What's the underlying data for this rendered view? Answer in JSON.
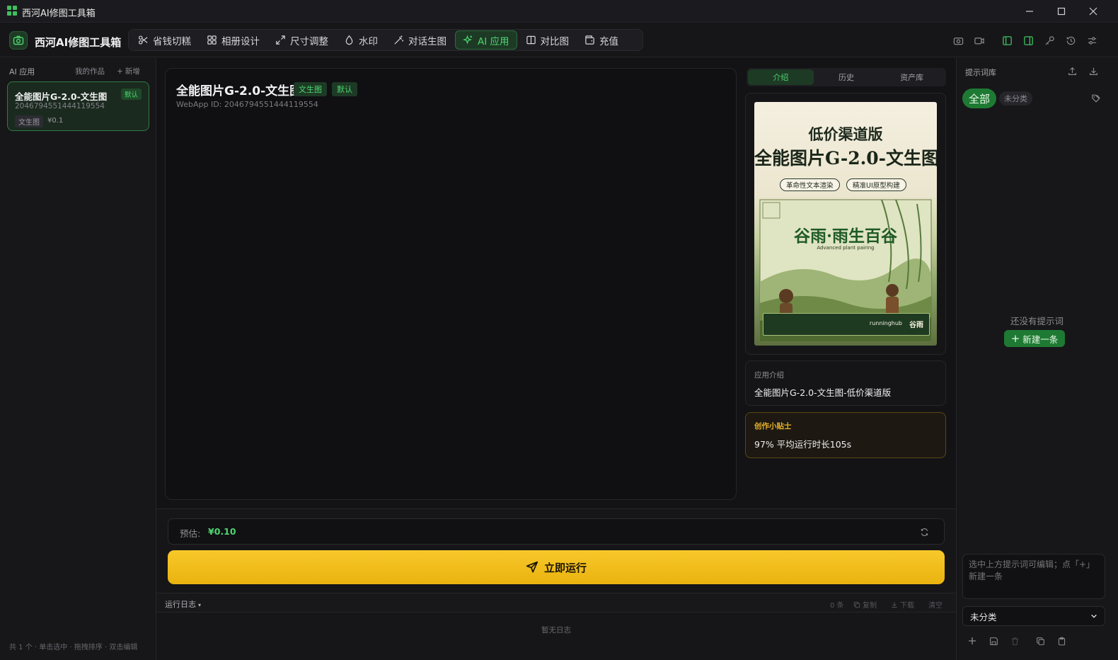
{
  "window": {
    "title": "西河AI修图工具箱"
  },
  "brand": {
    "name": "西河AI修图工具箱"
  },
  "tabs": [
    {
      "label": "省钱切糕",
      "icon": "scissors-icon"
    },
    {
      "label": "相册设计",
      "icon": "grid-icon"
    },
    {
      "label": "尺寸调整",
      "icon": "expand-icon"
    },
    {
      "label": "水印",
      "icon": "droplet-icon"
    },
    {
      "label": "对话生图",
      "icon": "magic-wand-icon"
    },
    {
      "label": "AI 应用",
      "icon": "sparkle-icon",
      "active": true
    },
    {
      "label": "对比图",
      "icon": "columns-icon"
    },
    {
      "label": "充值",
      "icon": "wallet-icon"
    }
  ],
  "left": {
    "title": "AI 应用",
    "my_works": "我的作品",
    "add": "新增",
    "apps": [
      {
        "name": "全能图片G-2.0-文生图",
        "id": "2046794551444119554",
        "badge": "默认",
        "tag": "文生图",
        "price": "¥0.1"
      }
    ],
    "footer": "共 1 个 · 单击选中 · 拖拽排序 · 双击编辑"
  },
  "main": {
    "title": "全能图片G-2.0-文生图",
    "badge1": "文生图",
    "badge2": "默认",
    "webapp_id": "WebApp ID: 2046794551444119554"
  },
  "info": {
    "tabs": [
      "介绍",
      "历史",
      "资产库"
    ],
    "poster": {
      "line1": "低价渠道版",
      "line2": "全能图片G-2.0-文生图",
      "pill1": "革命性文本渲染",
      "pill2": "精准UI原型构建",
      "caption": "谷雨·雨生百谷",
      "caption_sub": "Advanced plant pairing",
      "footer_brand": "runninghub",
      "footer_mark": "谷雨"
    },
    "intro_label": "应用介绍",
    "intro_value": "全能图片G-2.0-文生图-低价渠道版",
    "tip_label": "创作小贴士",
    "tip_value": "97% 平均运行时长105s"
  },
  "bottom": {
    "estimate_label": "预估:",
    "estimate_value": "¥0.10",
    "run_label": "立即运行",
    "log_label": "运行日志",
    "log_count": "0 条",
    "log_copy": "复制",
    "log_download": "下载",
    "log_clear": "清空",
    "log_empty": "暂无日志"
  },
  "prompts": {
    "title": "提示词库",
    "chip_all": "全部",
    "chip_uncat": "未分类",
    "empty": "还没有提示词",
    "new_label": "新建一条",
    "editor_placeholder": "选中上方提示词可编辑；点「+」新建一条",
    "category": "未分类"
  },
  "colors": {
    "accent": "#4fd56f",
    "run": "#f2be1d",
    "tip": "#e7b12a"
  }
}
